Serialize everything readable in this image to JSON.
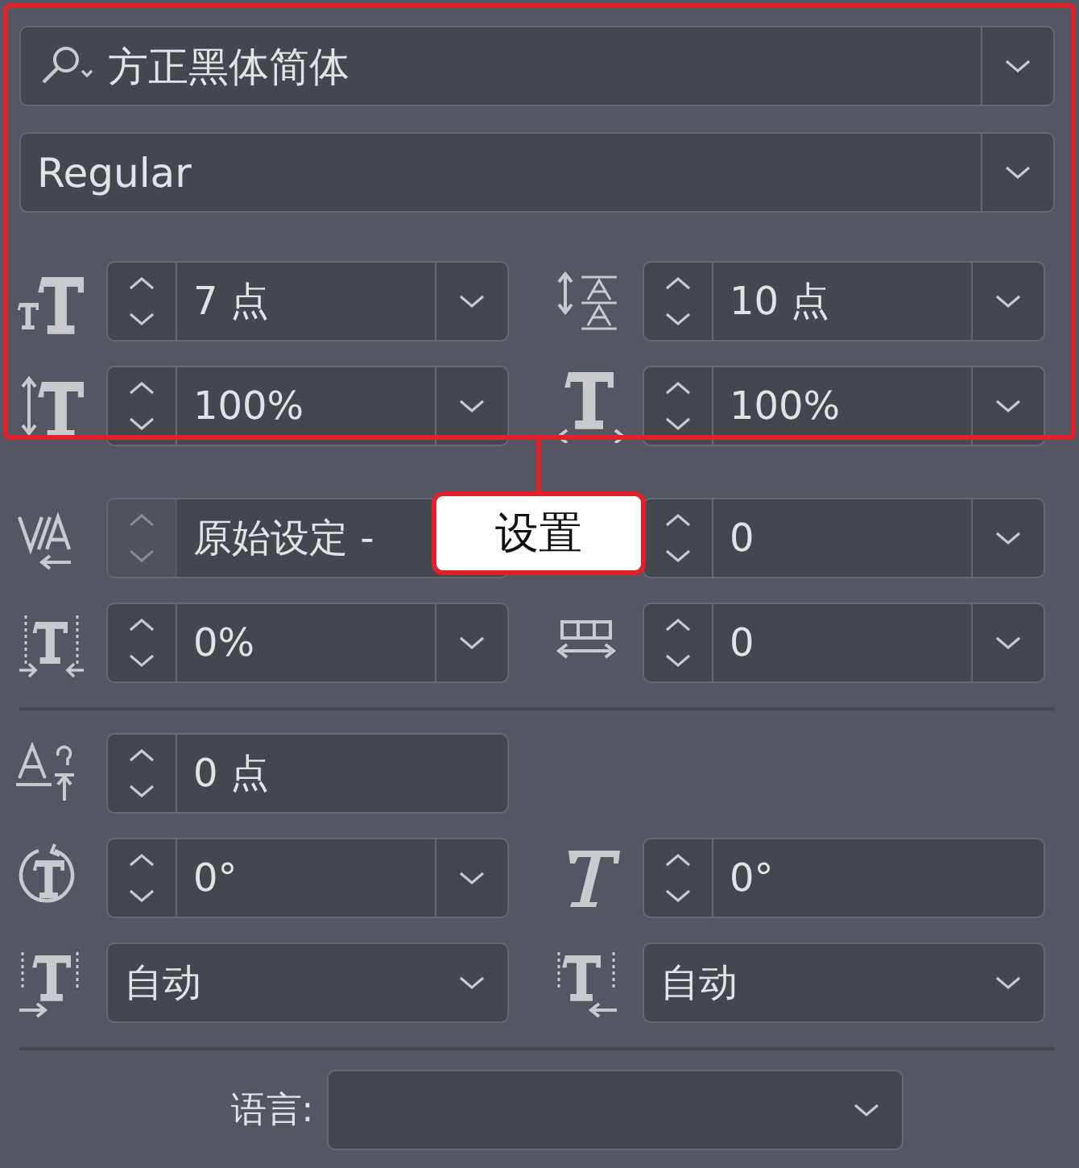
{
  "font_family": {
    "value": "方正黑体简体"
  },
  "font_style": {
    "value": "Regular"
  },
  "sections": [
    {
      "rows": [
        [
          {
            "kind": "spin-combo",
            "value": "7 点",
            "spinner_disabled": false
          },
          {
            "kind": "spin-combo",
            "value": "10 点",
            "spinner_disabled": false
          }
        ],
        [
          {
            "kind": "spin-combo",
            "value": "100%",
            "spinner_disabled": false
          },
          {
            "kind": "spin-combo",
            "value": "100%",
            "spinner_disabled": false
          }
        ]
      ]
    },
    {
      "rows": [
        [
          {
            "kind": "spin-field",
            "value": "原始设定 -",
            "spinner_disabled": true
          },
          {
            "kind": "spin-combo",
            "value": "0",
            "spinner_disabled": false
          }
        ],
        [
          {
            "kind": "spin-combo",
            "value": "0%",
            "spinner_disabled": false
          },
          {
            "kind": "spin-combo",
            "value": "0",
            "spinner_disabled": false
          }
        ]
      ]
    },
    {
      "rows": [
        [
          {
            "kind": "spin-field",
            "value": "0 点",
            "spinner_disabled": false
          }
        ],
        [
          {
            "kind": "spin-combo",
            "value": "0°",
            "spinner_disabled": false
          },
          {
            "kind": "spin-field",
            "value": "0°",
            "spinner_disabled": false
          }
        ],
        [
          {
            "kind": "combo",
            "value": "自动"
          },
          {
            "kind": "combo",
            "value": "自动"
          }
        ]
      ]
    }
  ],
  "language": {
    "label": "语言:"
  },
  "callout": {
    "label": "设置"
  }
}
